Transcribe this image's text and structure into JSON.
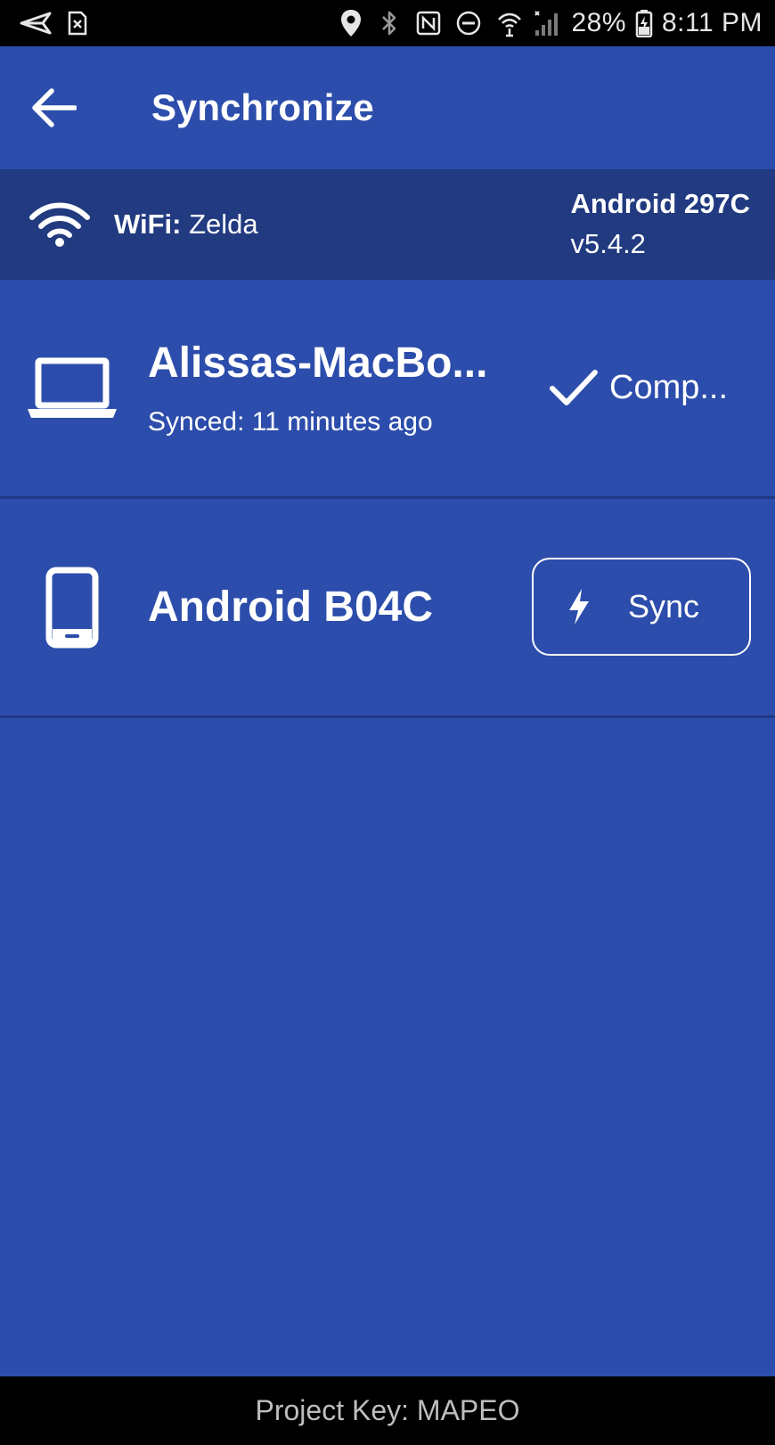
{
  "status_bar": {
    "battery": "28%",
    "time": "8:11 PM",
    "icons": [
      "send-icon",
      "sim-error-icon",
      "location-icon",
      "bluetooth-icon",
      "nfc-icon",
      "do-not-disturb-icon",
      "wifi-calling-icon",
      "signal-icon",
      "battery-charging-icon"
    ]
  },
  "app_bar": {
    "title": "Synchronize",
    "back_icon": "arrow-back-icon"
  },
  "wifi_banner": {
    "label": "WiFi:",
    "network": "Zelda",
    "device_name": "Android 297C",
    "version": "v5.4.2",
    "icon": "wifi-icon"
  },
  "peers": [
    {
      "name": "Alissas-MacBo...",
      "subtitle": "Synced: 11 minutes ago",
      "status": "Comp...",
      "icon": "laptop-icon"
    },
    {
      "name": "Android B04C",
      "button_label": "Sync",
      "icon": "phone-icon",
      "button_icon": "lightning-icon"
    }
  ],
  "footer": {
    "text": "Project Key: MAPEO"
  },
  "colors": {
    "background": "#2c4dab",
    "banner": "#213a80",
    "divider": "#1f3a85",
    "bar": "#000000"
  }
}
